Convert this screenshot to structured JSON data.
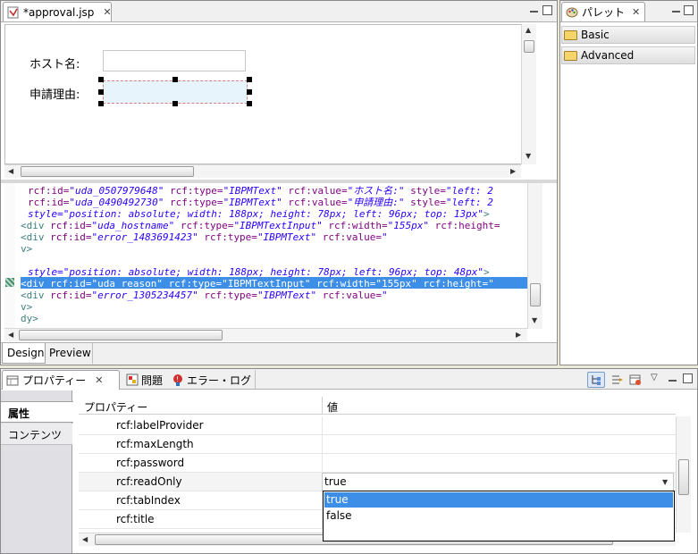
{
  "editor": {
    "tab_title": "*approval.jsp",
    "design_labels": [
      "ホスト名:",
      "申請理由:"
    ],
    "code_lines": [
      [
        [
          "attr",
          "rcf:id="
        ],
        [
          "val",
          "\"uda_0507979648\""
        ],
        [
          "attr",
          " rcf:type="
        ],
        [
          "val",
          "\"IBPMText\""
        ],
        [
          "attr",
          " rcf:value="
        ],
        [
          "val",
          "\"ホスト名:\""
        ],
        [
          "attr",
          " style="
        ],
        [
          "val",
          "\"left: 2"
        ]
      ],
      [
        [
          "attr",
          "rcf:id="
        ],
        [
          "val",
          "\"uda_0490492730\""
        ],
        [
          "attr",
          " rcf:type="
        ],
        [
          "val",
          "\"IBPMText\""
        ],
        [
          "attr",
          " rcf:value="
        ],
        [
          "val",
          "\"申請理由:\""
        ],
        [
          "attr",
          " style="
        ],
        [
          "val",
          "\"left: 2"
        ]
      ],
      [
        [
          "val",
          "style=\"position: absolute; width: 188px; height: 78px; left: 96px; top: 13px\""
        ],
        [
          "kw",
          ">"
        ]
      ],
      [
        [
          "kw",
          "<div "
        ],
        [
          "attr",
          "rcf:id="
        ],
        [
          "val",
          "\"uda_hostname\""
        ],
        [
          "attr",
          " rcf:type="
        ],
        [
          "val",
          "\"IBPMTextInput\""
        ],
        [
          "attr",
          " rcf:width="
        ],
        [
          "val",
          "\"155px\""
        ],
        [
          "attr",
          " rcf:height="
        ]
      ],
      [
        [
          "kw",
          "<div "
        ],
        [
          "attr",
          "rcf:id="
        ],
        [
          "val",
          "\"error_1483691423\""
        ],
        [
          "attr",
          " rcf:type="
        ],
        [
          "val",
          "\"IBPMText\""
        ],
        [
          "attr",
          " rcf:value="
        ],
        [
          "val",
          "\""
        ]
      ],
      [
        [
          "kw",
          "v>"
        ]
      ],
      [
        [
          "plain",
          ""
        ]
      ],
      [
        [
          "val",
          "style=\"position: absolute; width: 188px; height: 78px; left: 96px; top: 48px\""
        ],
        [
          "kw",
          ">"
        ]
      ],
      [
        [
          "plain",
          "<div rcf:id=\"uda_reason\" rcf:type=\"IBPMTextInput\" rcf:width=\"155px\" rcf:height=\""
        ]
      ],
      [
        [
          "kw",
          "<div "
        ],
        [
          "attr",
          "rcf:id="
        ],
        [
          "val",
          "\"error_1305234457\""
        ],
        [
          "attr",
          " rcf:type="
        ],
        [
          "val",
          "\"IBPMText\""
        ],
        [
          "attr",
          " rcf:value="
        ],
        [
          "val",
          "\""
        ]
      ],
      [
        [
          "kw",
          "v>"
        ]
      ],
      [
        [
          "kw",
          "dy>"
        ]
      ]
    ],
    "bottom_tabs": [
      "Design",
      "Preview"
    ]
  },
  "palette": {
    "title": "パレット",
    "drawers": [
      "Basic",
      "Advanced"
    ]
  },
  "properties": {
    "tabs": [
      "プロパティー",
      "問題",
      "エラー・ログ"
    ],
    "side_tabs": [
      "属性",
      "コンテンツ"
    ],
    "header": {
      "name": "プロパティー",
      "value": "値"
    },
    "rows": [
      {
        "name": "rcf:labelProvider",
        "value": ""
      },
      {
        "name": "rcf:maxLength",
        "value": ""
      },
      {
        "name": "rcf:password",
        "value": ""
      },
      {
        "name": "rcf:readOnly",
        "value": "true"
      },
      {
        "name": "rcf:tabIndex",
        "value": ""
      },
      {
        "name": "rcf:title",
        "value": ""
      }
    ],
    "dropdown_options": [
      "true",
      "false"
    ],
    "selected_option": "true"
  },
  "colors": {
    "selection": "#3d8ee7",
    "dropdown_highlight": "#3d8ee7"
  }
}
